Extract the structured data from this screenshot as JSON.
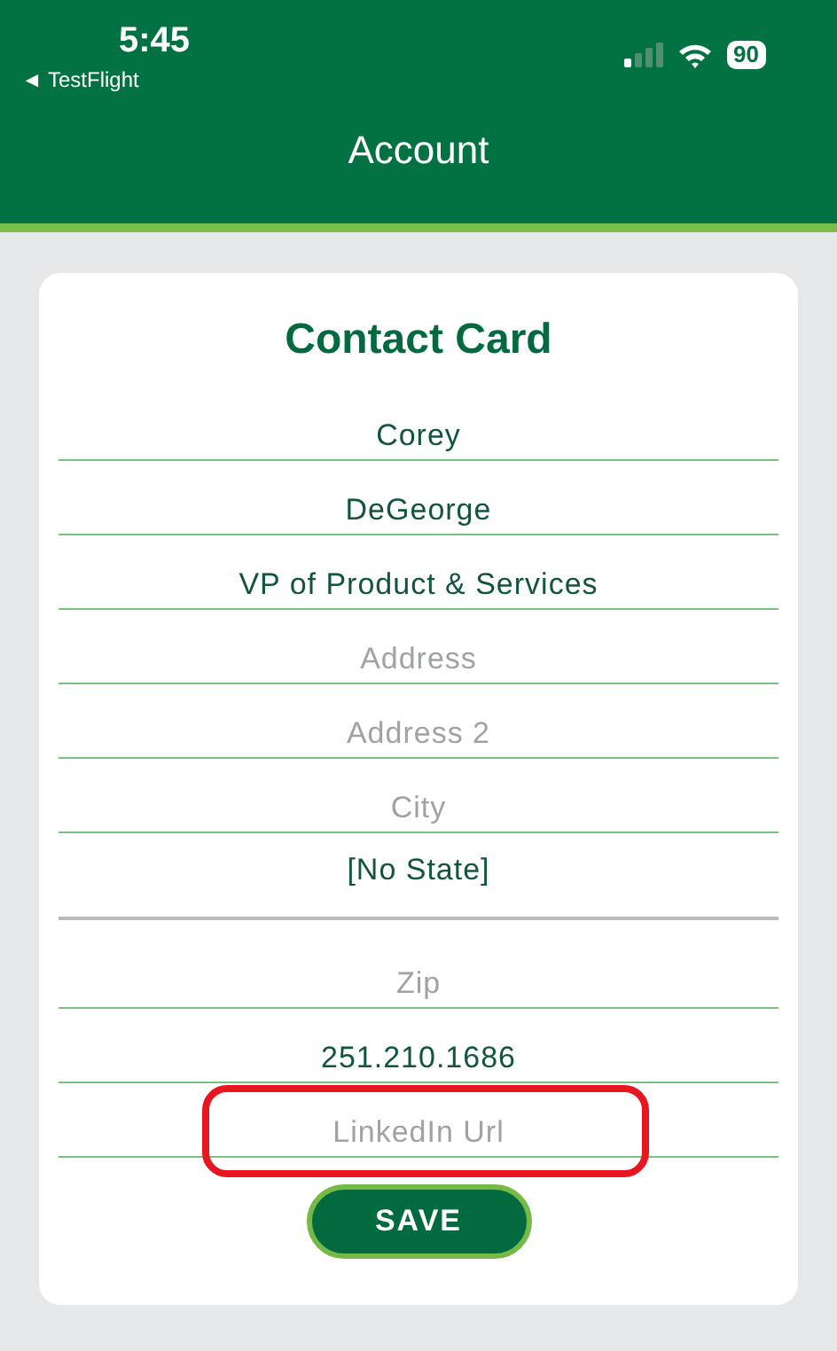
{
  "status_bar": {
    "time": "5:45",
    "back_app": "◄ TestFlight",
    "battery": "90"
  },
  "header": {
    "title": "Account"
  },
  "card": {
    "title": "Contact Card",
    "fields": [
      {
        "kind": "text",
        "value": "Corey"
      },
      {
        "kind": "text",
        "value": "DeGeorge"
      },
      {
        "kind": "text",
        "value": "VP of Product & Services"
      },
      {
        "kind": "text",
        "placeholder": "Address"
      },
      {
        "kind": "text",
        "placeholder": "Address 2"
      },
      {
        "kind": "text",
        "placeholder": "City"
      },
      {
        "kind": "dropdown",
        "value": "[No State]"
      },
      {
        "kind": "text",
        "placeholder": "Zip"
      },
      {
        "kind": "text",
        "value": "251.210.1686"
      },
      {
        "kind": "text",
        "placeholder": "LinkedIn Url",
        "annotated": true
      }
    ],
    "button": "SAVE"
  }
}
